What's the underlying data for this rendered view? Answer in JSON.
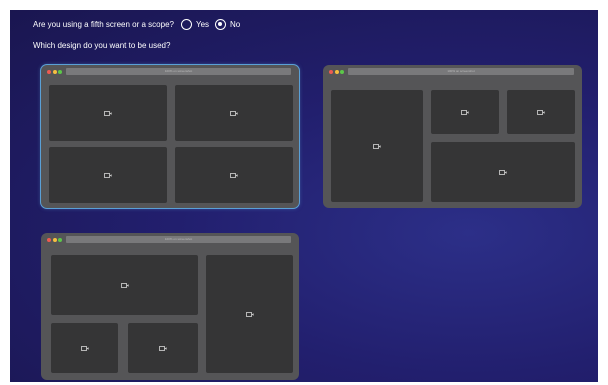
{
  "question1": {
    "text": "Are you using a fifth screen or a scope?",
    "options": [
      {
        "label": "Yes",
        "checked": false
      },
      {
        "label": "No",
        "checked": true
      }
    ]
  },
  "question2": {
    "text": "Which design do you want to be used?"
  },
  "designs": [
    {
      "url": "100% on screenshot",
      "selected": true,
      "tile_count": 4,
      "icon": "video-camera-icon"
    },
    {
      "url": "100% on screenshot",
      "selected": false,
      "tile_count": 4,
      "icon": "video-camera-icon"
    },
    {
      "url": "100% on screenshot",
      "selected": false,
      "tile_count": 4,
      "icon": "video-camera-icon"
    }
  ],
  "colors": {
    "background": "#221f6e",
    "window": "#555557",
    "tile": "#353536",
    "selection": "#5aa0d6"
  }
}
